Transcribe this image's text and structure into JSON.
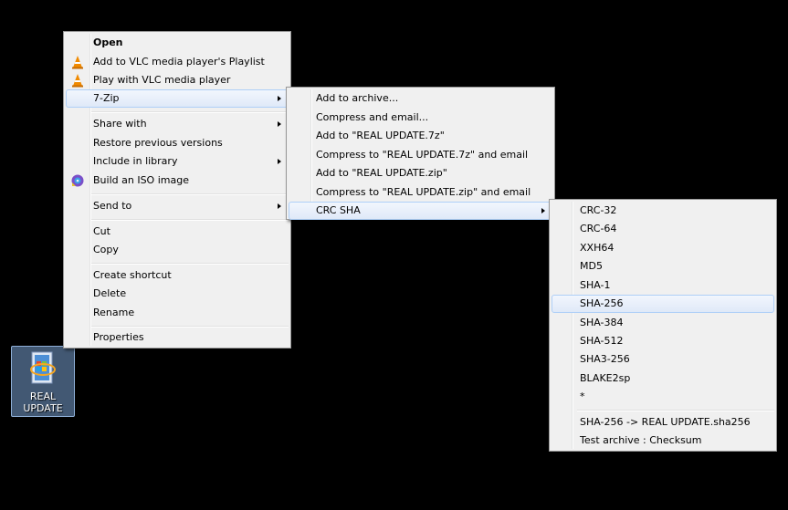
{
  "desktop_icon": {
    "label_line1": "REAL",
    "label_line2": "UPDATE"
  },
  "context_menu": {
    "items": [
      {
        "label": "Open"
      },
      {
        "label": "Add to VLC media player's Playlist"
      },
      {
        "label": "Play with VLC media player"
      },
      {
        "label": "7-Zip"
      },
      {
        "label": "Share with"
      },
      {
        "label": "Restore previous versions"
      },
      {
        "label": "Include in library"
      },
      {
        "label": "Build an ISO image"
      },
      {
        "label": "Send to"
      },
      {
        "label": "Cut"
      },
      {
        "label": "Copy"
      },
      {
        "label": "Create shortcut"
      },
      {
        "label": "Delete"
      },
      {
        "label": "Rename"
      },
      {
        "label": "Properties"
      }
    ]
  },
  "sevenzip_menu": {
    "items": [
      {
        "label": "Add to archive..."
      },
      {
        "label": "Compress and email..."
      },
      {
        "label": "Add to \"REAL UPDATE.7z\""
      },
      {
        "label": "Compress to \"REAL UPDATE.7z\" and email"
      },
      {
        "label": "Add to \"REAL UPDATE.zip\""
      },
      {
        "label": "Compress to \"REAL UPDATE.zip\" and email"
      },
      {
        "label": "CRC SHA"
      }
    ]
  },
  "crc_menu": {
    "items": [
      {
        "label": "CRC-32"
      },
      {
        "label": "CRC-64"
      },
      {
        "label": "XXH64"
      },
      {
        "label": "MD5"
      },
      {
        "label": "SHA-1"
      },
      {
        "label": "SHA-256"
      },
      {
        "label": "SHA-384"
      },
      {
        "label": "SHA-512"
      },
      {
        "label": "SHA3-256"
      },
      {
        "label": "BLAKE2sp"
      },
      {
        "label": "*"
      },
      {
        "label": "SHA-256 -> REAL UPDATE.sha256"
      },
      {
        "label": "Test archive : Checksum"
      }
    ]
  },
  "colors": {
    "highlight_border": "#aecff7",
    "menu_bg": "#f0f0f0",
    "vlc_orange": "#f08a00"
  },
  "icons": [
    "vlc-cone-icon",
    "iso-disc-icon",
    "submenu-arrow-icon",
    "setup-package-icon"
  ]
}
